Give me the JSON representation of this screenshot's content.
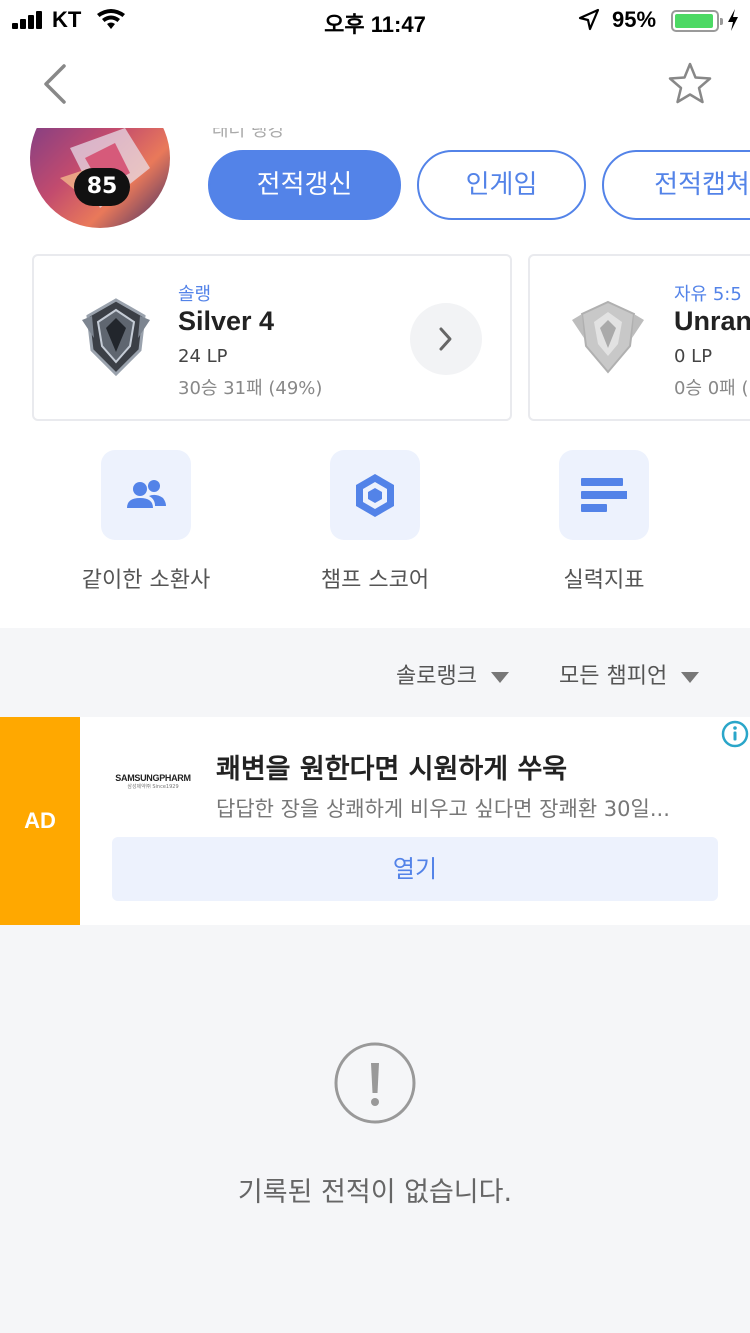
{
  "status_bar": {
    "carrier": "KT",
    "time": "오후 11:47",
    "battery_percent": "95%",
    "battery_level": 0.95
  },
  "profile": {
    "level": "85",
    "ladder_text": "래더 랭킹 ",
    "buttons": {
      "refresh": "전적갱신",
      "ingame": "인게임",
      "capture": "전적캡쳐"
    }
  },
  "ranks": {
    "solo": {
      "queue": "솔랭",
      "tier": "Silver 4",
      "lp": "24 LP",
      "record": "30승 31패 (49%)"
    },
    "flex": {
      "queue": "자유 5:5",
      "tier": "Unranked",
      "lp": "0 LP",
      "record": "0승 0패 ("
    }
  },
  "shortcuts": [
    {
      "label": "같이한 소환사",
      "icon": "users-icon"
    },
    {
      "label": "챔프 스코어",
      "icon": "hexagon-icon"
    },
    {
      "label": "실력지표",
      "icon": "bars-icon"
    }
  ],
  "filters": {
    "queue": "솔로랭크",
    "champion": "모든 챔피언"
  },
  "ad": {
    "tag": "AD",
    "brand": "SAMSUNGPHARM",
    "brand_sub": "삼성제약㈜ Since1929",
    "title": "쾌변을 원한다면 시원하게 쑤욱",
    "description": "답답한 장을 상쾌하게 비우고 싶다면 장쾌환 30일...",
    "cta": "열기"
  },
  "empty_state": {
    "message": "기록된 전적이 없습니다."
  },
  "colors": {
    "accent": "#5383e8",
    "ad_tag": "#ffa800",
    "battery": "#4cd964"
  }
}
